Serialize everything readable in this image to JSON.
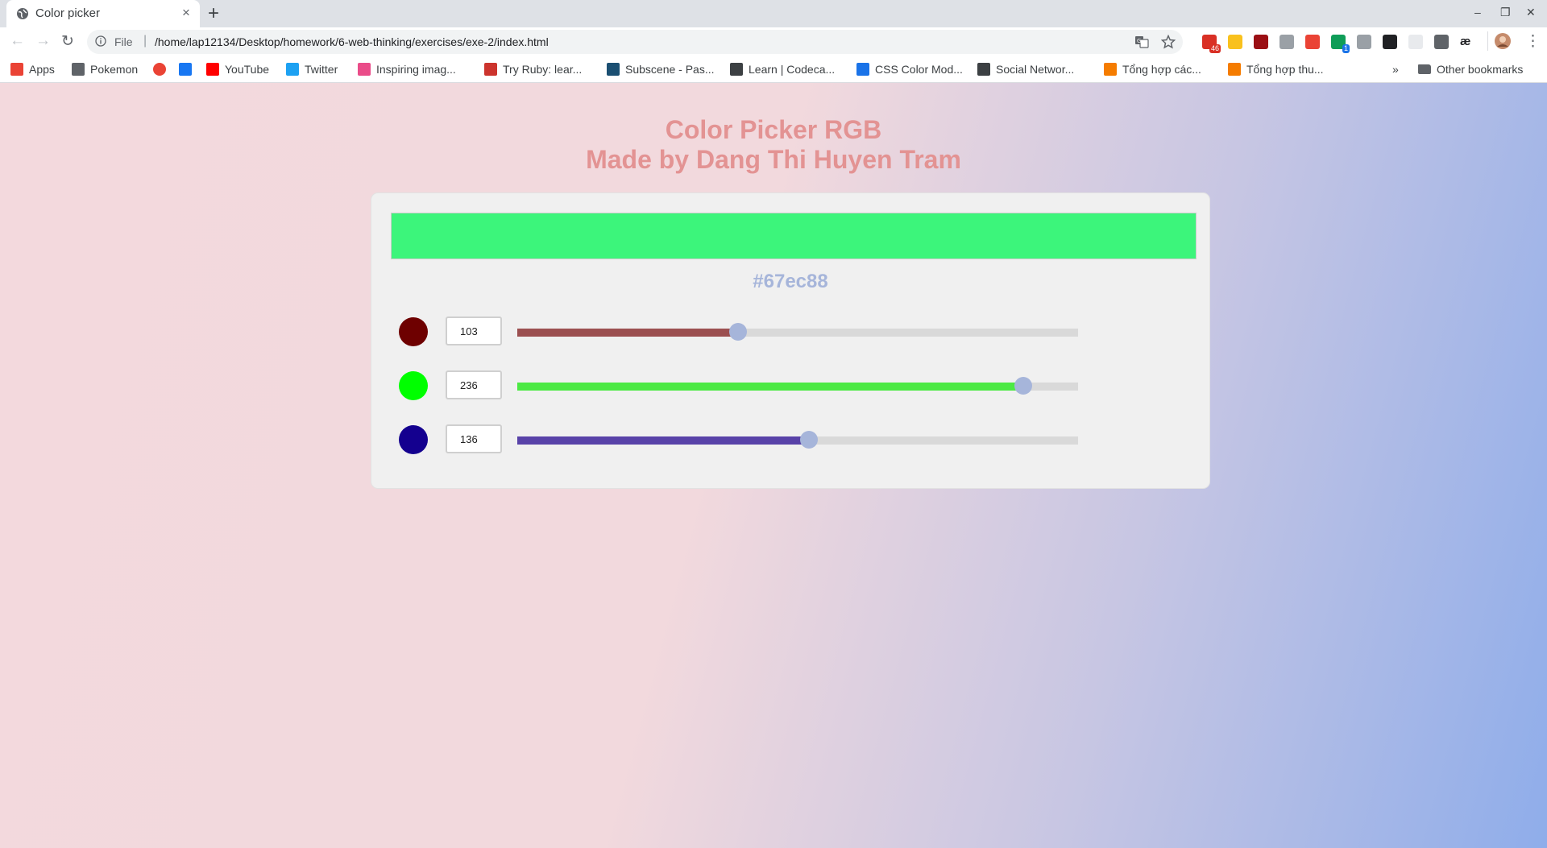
{
  "browser": {
    "tab_title": "Color picker",
    "new_tab_label": "+",
    "close_tab_label": "×",
    "window_buttons": {
      "minimize": "–",
      "restore": "❐",
      "close": "✕"
    },
    "omnibox": {
      "scheme": "File",
      "separator": "|",
      "url": "/home/lap12134/Desktop/homework/6-web-thinking/exercises/exe-2/index.html"
    },
    "nav": {
      "back": "←",
      "forward": "→",
      "reload": "↻",
      "menu": "⋮"
    },
    "extensions": [
      {
        "icon": "gmail-icon",
        "color": "#d93025",
        "badge": "46"
      },
      {
        "icon": "note-icon",
        "color": "#f9c11d"
      },
      {
        "icon": "ublock-icon",
        "color": "#9b0f14"
      },
      {
        "icon": "circle-extension-icon",
        "color": "#9aa0a6"
      },
      {
        "icon": "link-extension-icon",
        "color": "#ea4335"
      },
      {
        "icon": "green-extension-icon",
        "color": "#0f9d58",
        "badge": "1"
      },
      {
        "icon": "camera-icon",
        "color": "#9aa0a6"
      },
      {
        "icon": "swirl-extension-icon",
        "color": "#202124"
      },
      {
        "icon": "blank-extension-icon",
        "color": "#e8eaed"
      },
      {
        "icon": "facebook-icon",
        "color": "#5f6368"
      },
      {
        "icon": "ae-extension-icon",
        "color": "#202124",
        "label": "æ"
      }
    ],
    "bookmarks": [
      {
        "label": "Apps",
        "icon": "apps-grid-icon",
        "color": "#ea4335"
      },
      {
        "label": "Pokemon",
        "icon": "folder-icon",
        "color": "#5f6368"
      },
      {
        "label": "",
        "icon": "colorful-circle-icon",
        "color": "#ea4335"
      },
      {
        "label": "",
        "icon": "facebook-icon",
        "color": "#1877f2"
      },
      {
        "label": "YouTube",
        "icon": "youtube-icon",
        "color": "#ff0000"
      },
      {
        "label": "Twitter",
        "icon": "twitter-icon",
        "color": "#1da1f2"
      },
      {
        "label": "Inspiring imag...",
        "icon": "heart-icon",
        "color": "#ea4c89"
      },
      {
        "label": "Try Ruby: lear...",
        "icon": "ruby-icon",
        "color": "#cc342d"
      },
      {
        "label": "Subscene - Pas...",
        "icon": "subscene-icon",
        "color": "#1b4f72"
      },
      {
        "label": "Learn | Codeca...",
        "icon": "codecademy-icon",
        "color": "#3c4043"
      },
      {
        "label": "CSS Color Mod...",
        "icon": "w3schools-icon",
        "color": "#1a73e8"
      },
      {
        "label": "Social Networ...",
        "icon": "codecademy-icon",
        "color": "#3c4043"
      },
      {
        "label": "Tổng hợp các...",
        "icon": "j-icon",
        "color": "#f57c00"
      },
      {
        "label": "Tổng hợp thu...",
        "icon": "j-icon",
        "color": "#f57c00"
      }
    ],
    "more_bookmarks": "»",
    "other_bookmarks": "Other bookmarks"
  },
  "app": {
    "title_line1": "Color Picker RGB",
    "title_line2": "Made by Dang Thi Huyen Tram",
    "hex_value": "#67ec88",
    "preview_color": "#3cf57b",
    "channels": [
      {
        "name": "red",
        "value": "103",
        "level": 103,
        "swatch_color": "#6e0000",
        "fill_color": "#9b4f50"
      },
      {
        "name": "green",
        "value": "236",
        "level": 236,
        "swatch_color": "#00ff00",
        "fill_color": "#4ce944"
      },
      {
        "name": "blue",
        "value": "136",
        "level": 136,
        "swatch_color": "#14008f",
        "fill_color": "#5842a8"
      }
    ],
    "max": 255
  }
}
